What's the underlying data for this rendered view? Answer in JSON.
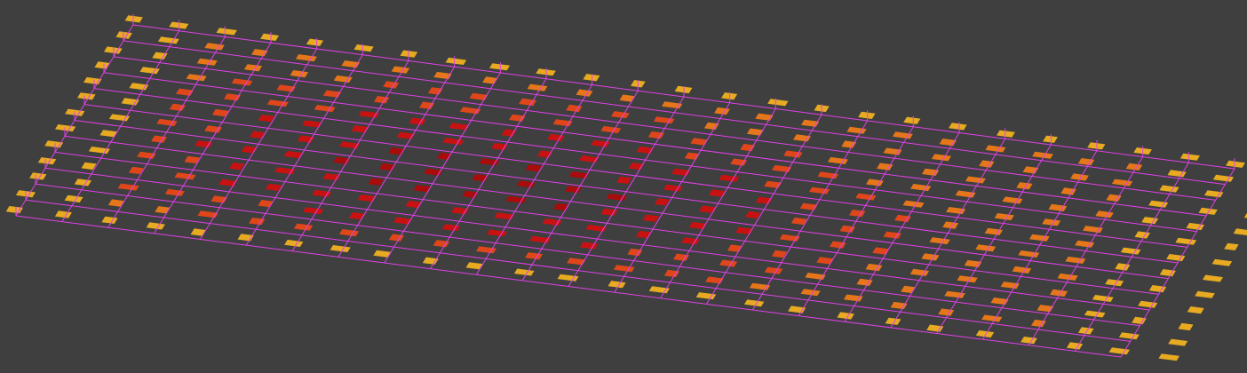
{
  "view": {
    "background": "#3f3f3f",
    "grid_color": "#e040e8",
    "grid_rows": 12,
    "grid_cols": 24
  },
  "palette": {
    "edge": "#f0b020",
    "mid": "#ee7a18",
    "inner": "#e84818",
    "core": "#d01010",
    "deep": "#b00808"
  }
}
